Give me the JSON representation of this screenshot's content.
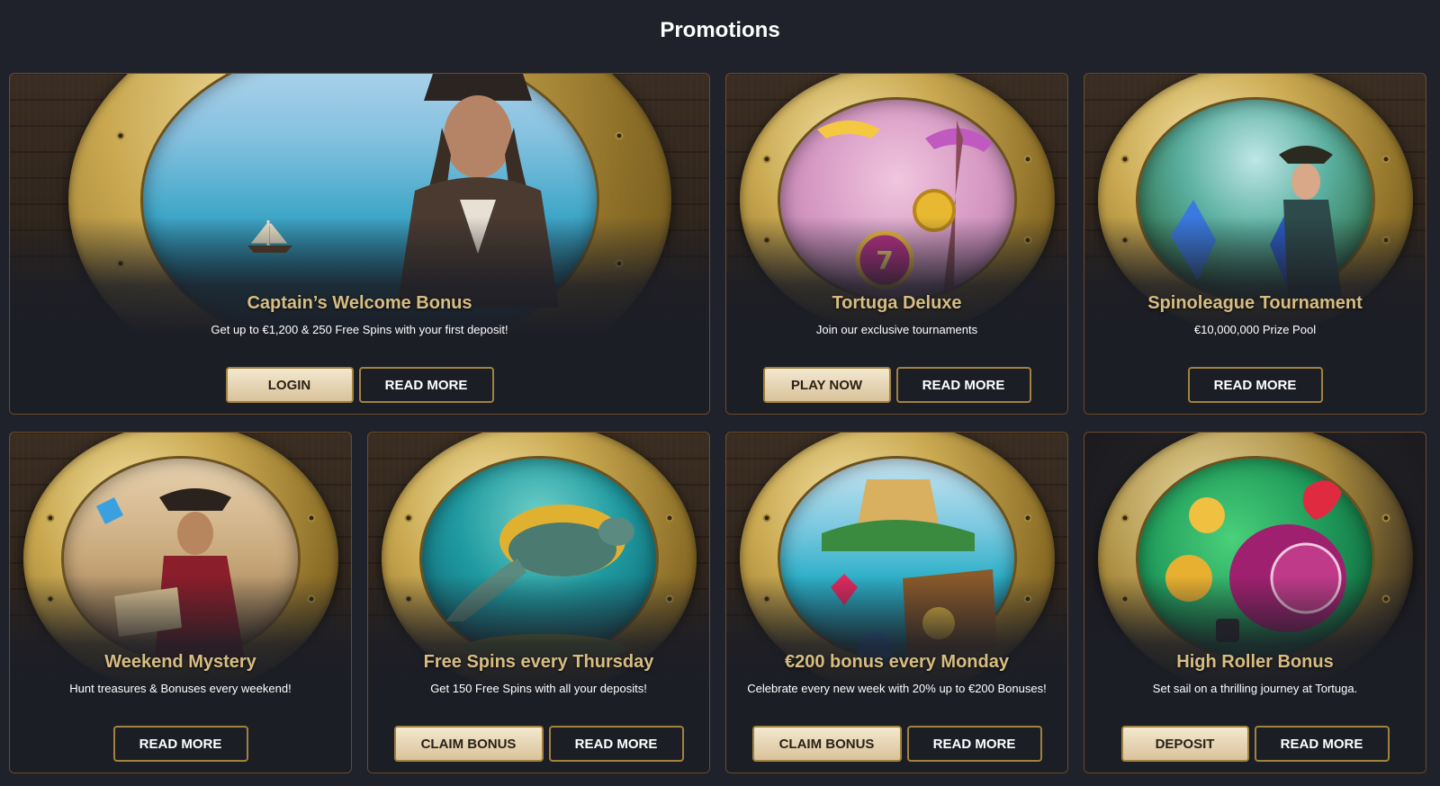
{
  "page": {
    "title": "Promotions"
  },
  "cards": [
    {
      "title": "Captain’s Welcome Bonus",
      "description": "Get up to €1,200 & 250 Free Spins with your first deposit!",
      "image": "pirate-captain-at-sea-illustration",
      "buttons": [
        {
          "label": "LOGIN",
          "style": "gold"
        },
        {
          "label": "READ MORE",
          "style": "dark"
        }
      ]
    },
    {
      "title": "Tortuga Deluxe",
      "description": "Join our exclusive tournaments",
      "image": "parachute-slot-coins-eiffel-tower-illustration",
      "buttons": [
        {
          "label": "PLAY NOW",
          "style": "gold"
        },
        {
          "label": "READ MORE",
          "style": "dark"
        }
      ]
    },
    {
      "title": "Spinoleague Tournament",
      "description": "€10,000,000 Prize Pool",
      "image": "pirate-woman-crystals-jungle-illustration",
      "buttons": [
        {
          "label": "READ MORE",
          "style": "dark"
        }
      ]
    },
    {
      "title": "Weekend Mystery",
      "description": "Hunt treasures & Bonuses every weekend!",
      "image": "pirate-reading-map-parrot-illustration",
      "buttons": [
        {
          "label": "READ MORE",
          "style": "dark"
        }
      ]
    },
    {
      "title": "Free Spins every Thursday",
      "description": "Get 150 Free Spins with all your deposits!",
      "image": "sea-turtle-underwater-illustration",
      "buttons": [
        {
          "label": "CLAIM BONUS",
          "style": "gold"
        },
        {
          "label": "READ MORE",
          "style": "dark"
        }
      ]
    },
    {
      "title": "€200 bonus every Monday",
      "description": "Celebrate every new week with 20% up to €200 Bonuses!",
      "image": "treasure-chest-island-illustration",
      "buttons": [
        {
          "label": "CLAIM BONUS",
          "style": "gold"
        },
        {
          "label": "READ MORE",
          "style": "dark"
        }
      ]
    },
    {
      "title": "High Roller Bonus",
      "description": "Set sail on a thrilling journey at Tortuga.",
      "image": "roulette-slot-coins-dice-illustration",
      "buttons": [
        {
          "label": "DEPOSIT",
          "style": "gold"
        },
        {
          "label": "READ MORE",
          "style": "dark"
        }
      ]
    }
  ],
  "colors": {
    "background": "#1f222b",
    "card_border": "#6b4a2a",
    "title_gold": "#d8bd82",
    "button_gold": "#e6d3ad",
    "button_border": "#a0823e"
  }
}
